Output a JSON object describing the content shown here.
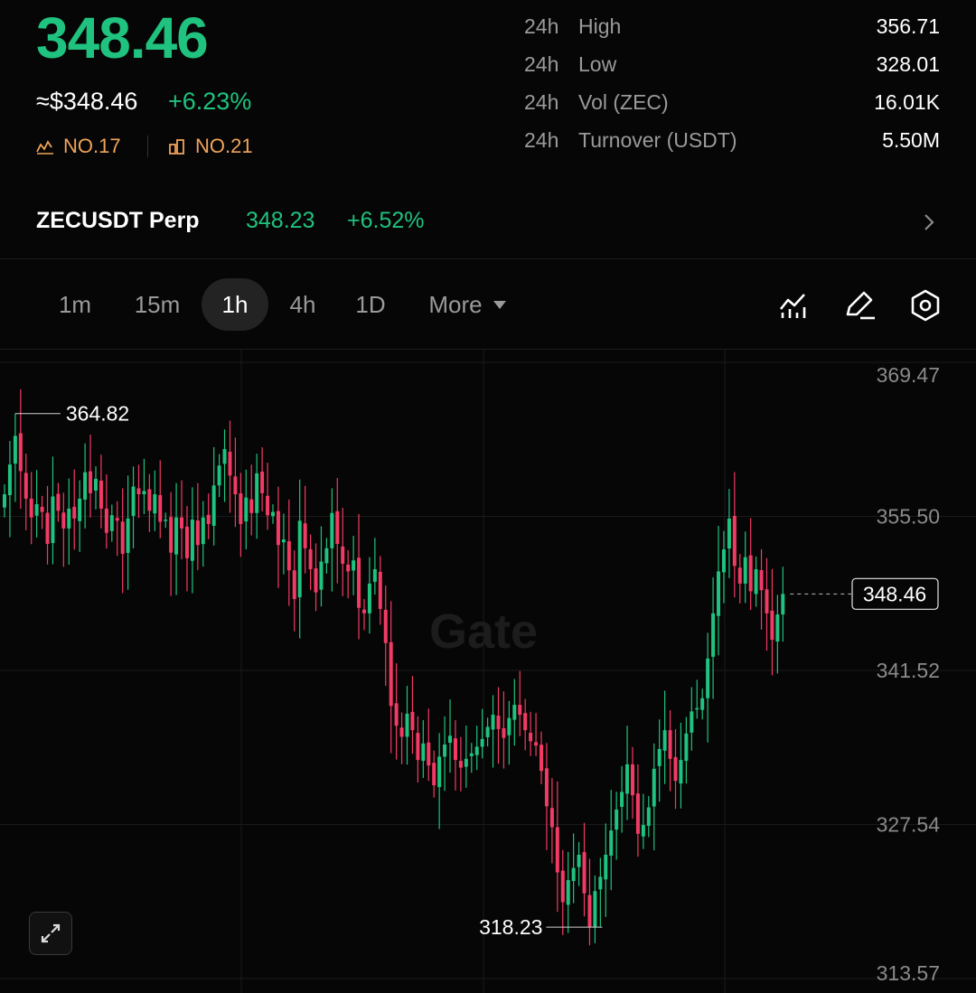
{
  "header": {
    "price": "348.46",
    "usd_price": "≈$348.46",
    "change_pct": "+6.23%",
    "rank_market": "NO.17",
    "rank_volume": "NO.21",
    "accent_up": "#1fc27e",
    "accent_down": "#f23b64",
    "rank_color": "#f0a45a"
  },
  "stats": [
    {
      "period": "24h",
      "label": "High",
      "value": "356.71"
    },
    {
      "period": "24h",
      "label": "Low",
      "value": "328.01"
    },
    {
      "period": "24h",
      "label": "Vol (ZEC)",
      "value": "16.01K"
    },
    {
      "period": "24h",
      "label": "Turnover (USDT)",
      "value": "5.50M"
    }
  ],
  "perp": {
    "name": "ZECUSDT Perp",
    "price": "348.23",
    "change": "+6.52%",
    "icon": "chevron-right-icon"
  },
  "timeframes": {
    "tabs": [
      "1m",
      "15m",
      "1h",
      "4h",
      "1D"
    ],
    "active": "1h",
    "more_label": "More"
  },
  "tools": [
    "indicator-icon",
    "draw-icon",
    "settings-icon"
  ],
  "chart": {
    "watermark": "Gate",
    "y_ticks": [
      "369.47",
      "355.50",
      "341.52",
      "327.54",
      "313.57"
    ],
    "high_label": "364.82",
    "low_label": "318.23",
    "last_price_label": "348.46",
    "expand_icon": "expand-icon"
  },
  "chart_data": {
    "type": "candlestick",
    "title": "",
    "ylim": [
      313.57,
      369.47
    ],
    "y_ticks": [
      369.47,
      355.5,
      341.52,
      327.54,
      313.57
    ],
    "high": 364.82,
    "low": 318.23,
    "last": 348.46,
    "closes": [
      357.5,
      360.2,
      362.8,
      359.6,
      357.1,
      355.4,
      356.6,
      355.9,
      353.0,
      357.3,
      356.0,
      354.4,
      356.2,
      355.3,
      357.1,
      359.5,
      357.6,
      358.9,
      356.2,
      354.0,
      355.6,
      355.1,
      352.1,
      355.3,
      358.2,
      357.5,
      357.8,
      356.0,
      357.5,
      355.0,
      355.2,
      352.2,
      355.4,
      354.4,
      351.7,
      355.2,
      352.9,
      355.4,
      354.8,
      358.3,
      360.1,
      361.6,
      359.2,
      357.5,
      354.8,
      357.2,
      355.8,
      359.4,
      357.6,
      355.6,
      355.9,
      352.9,
      353.4,
      350.6,
      348.0,
      355.1,
      352.6,
      350.7,
      348.6,
      351.4,
      352.6,
      355.8,
      353.0,
      351.2,
      350.5,
      351.5,
      347.2,
      346.7,
      349.4,
      350.7,
      347.1,
      344.0,
      338.3,
      336.5,
      335.5,
      337.6,
      336.1,
      333.4,
      334.9,
      332.9,
      331.1,
      333.7,
      334.8,
      335.6,
      333.4,
      332.7,
      333.5,
      334.0,
      334.6,
      335.3,
      336.4,
      337.5,
      336.2,
      335.4,
      337.2,
      338.4,
      337.5,
      336.1,
      335.1,
      334.7,
      332.4,
      329.2,
      327.3,
      323.2,
      320.5,
      322.5,
      323.6,
      324.8,
      321.3,
      318.2,
      321.5,
      322.8,
      324.8,
      327.0,
      328.9,
      330.5,
      333.0,
      330.2,
      326.7,
      327.5,
      329.1,
      332.6,
      334.4,
      336.1,
      333.5,
      331.5,
      333.4,
      335.8,
      337.8,
      338.1,
      339.0,
      342.6,
      346.7,
      350.5,
      352.5,
      355.3,
      351.0,
      349.4,
      351.8,
      348.7,
      350.7,
      348.8,
      346.7,
      344.3,
      346.6,
      348.46
    ]
  }
}
